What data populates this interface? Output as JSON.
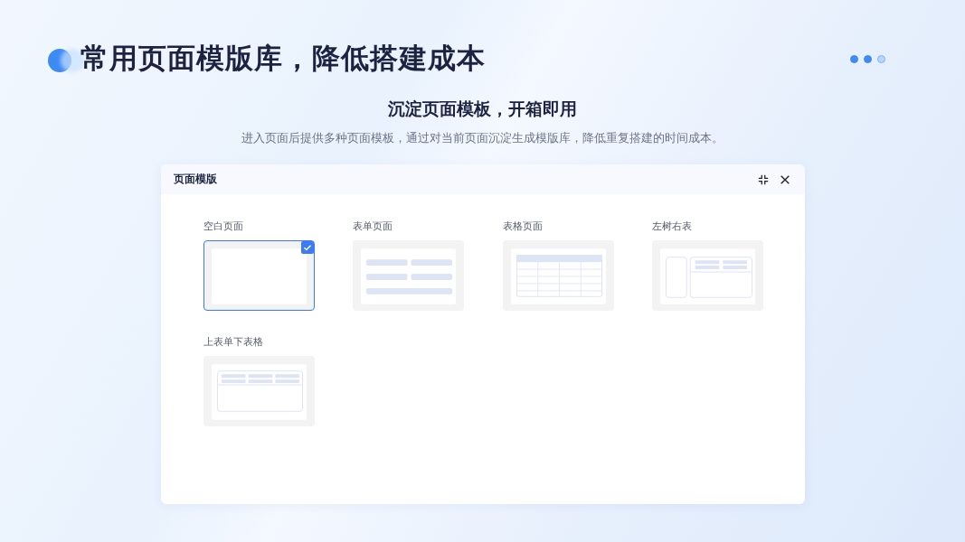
{
  "headline": "常用页面模版库，降低搭建成本",
  "pager": [
    {
      "selected": true
    },
    {
      "selected": true
    },
    {
      "selected": false
    }
  ],
  "subtitle": "沉淀页面模板，开箱即用",
  "description": "进入页面后提供多种页面模板，通过对当前页面沉淀生成模版库，降低重复搭建的时间成本。",
  "dialog": {
    "title": "页面模版",
    "templates": [
      {
        "label": "空白页面",
        "kind": "blank",
        "selected": true
      },
      {
        "label": "表单页面",
        "kind": "form",
        "selected": false
      },
      {
        "label": "表格页面",
        "kind": "table",
        "selected": false
      },
      {
        "label": "左树右表",
        "kind": "tree-table",
        "selected": false
      },
      {
        "label": "上表单下表格",
        "kind": "form-table",
        "selected": false
      }
    ]
  }
}
